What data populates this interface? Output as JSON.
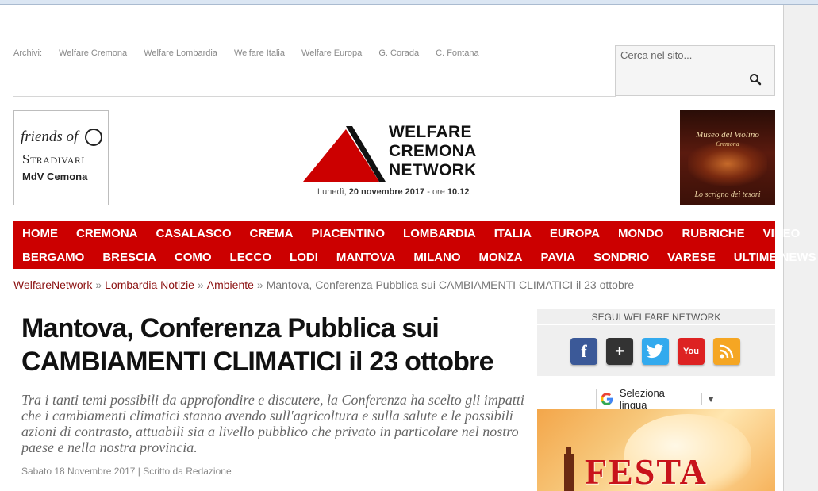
{
  "archive": {
    "label": "Archivi:",
    "links": [
      "Welfare Cremona",
      "Welfare Lombardia",
      "Welfare Italia",
      "Welfare Europa",
      "G. Corada",
      "C. Fontana"
    ]
  },
  "search": {
    "placeholder": "Cerca nel sito..."
  },
  "ad_left": {
    "line1": "friends of",
    "line2": "Stradivari",
    "line3": "MdV Cemona"
  },
  "logo": {
    "line1": "WELFARE",
    "line2": "CREMONA",
    "line3": "NETWORK"
  },
  "date": {
    "weekday": "Lunedì,",
    "day": "20 novembre 2017",
    "sep": "- ore",
    "time": "10.12"
  },
  "ad_right": {
    "title": "Museo del Violino",
    "subtitle": "Cremona",
    "tagline": "Lo scrigno dei tesori"
  },
  "nav": {
    "row1": [
      "HOME",
      "CREMONA",
      "CASALASCO",
      "CREMA",
      "PIACENTINO",
      "LOMBARDIA",
      "ITALIA",
      "EUROPA",
      "MONDO",
      "RUBRICHE",
      "VIDEO"
    ],
    "row2": [
      "BERGAMO",
      "BRESCIA",
      "COMO",
      "LECCO",
      "LODI",
      "MANTOVA",
      "MILANO",
      "MONZA",
      "PAVIA",
      "SONDRIO",
      "VARESE",
      "ULTIME NEWS"
    ]
  },
  "breadcrumb": {
    "items": [
      "WelfareNetwork",
      "Lombardia Notizie",
      "Ambiente"
    ],
    "separator": "»",
    "current": "Mantova, Conferenza Pubblica sui CAMBIAMENTI CLIMATICI il 23 ottobre"
  },
  "article": {
    "title_line1": "Mantova, Conferenza Pubblica sui",
    "title_line2": "CAMBIAMENTI CLIMATICI il 23 ottobre",
    "lead": "Tra i tanti temi possibili da approfondire e discutere, la Conferenza ha scelto gli impatti che i cambiamenti climatici stanno avendo sull'agricoltura e sulla salute e le possibili azioni di contrasto, attuabili sia a livello pubblico che privato in particolare nel nostro paese e nella nostra provincia.",
    "meta": "Sabato 18 Novembre 2017 | Scritto da Redazione"
  },
  "follow": {
    "heading": "SEGUI WELFARE NETWORK",
    "icons": [
      {
        "name": "facebook-icon",
        "glyph": "f",
        "color": "#3b5998"
      },
      {
        "name": "google-plus-icon",
        "glyph": "+",
        "color": "#333333"
      },
      {
        "name": "twitter-icon",
        "glyph": "t",
        "color": "#33aaee"
      },
      {
        "name": "youtube-icon",
        "glyph": "You",
        "color": "#dd2222"
      },
      {
        "name": "rss-icon",
        "glyph": "))",
        "color": "#f5a623"
      }
    ]
  },
  "translate": {
    "label": "Seleziona lingua",
    "arrow": "▼"
  },
  "festa_ad": {
    "text": "FESTA"
  },
  "colors": {
    "nav_red": "#cc0000",
    "link_red": "#8b1010"
  }
}
